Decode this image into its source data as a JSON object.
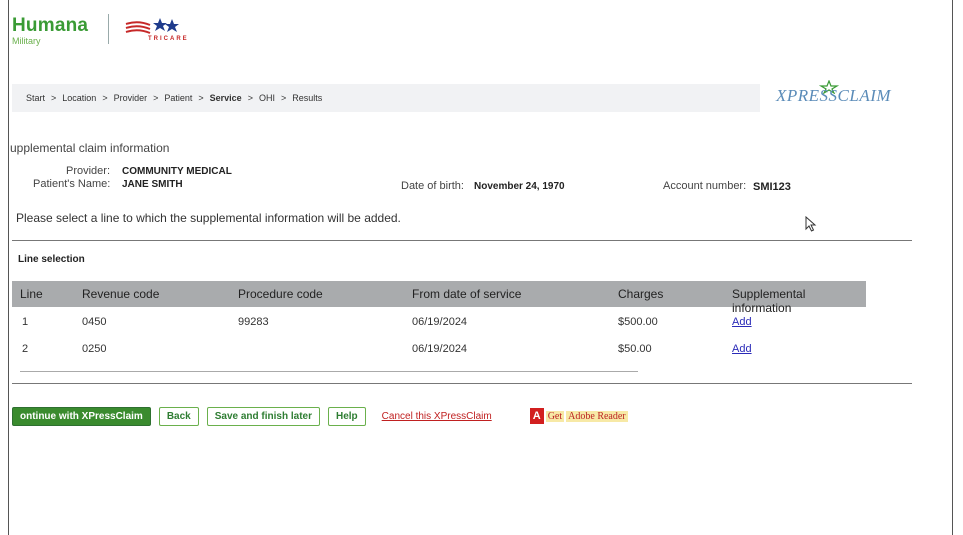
{
  "branding": {
    "humana": "Humana",
    "military": "Military",
    "tricare": "TRICARE",
    "xpressclaim_logo": "XPRESSCLAIM"
  },
  "breadcrumb": [
    {
      "label": "Start"
    },
    {
      "label": "Location"
    },
    {
      "label": "Provider"
    },
    {
      "label": "Patient"
    },
    {
      "label": "Service"
    },
    {
      "label": "OHI"
    },
    {
      "label": "Results"
    }
  ],
  "breadcrumb_separator": ">",
  "claim": {
    "section_title": "upplemental claim information",
    "provider_label": "Provider:",
    "provider_value": "COMMUNITY MEDICAL",
    "patient_label": "Patient's Name:",
    "patient_value": "JANE SMITH",
    "dob_label": "Date of birth:",
    "dob_value": "November 24, 1970",
    "account_label": "Account number:",
    "account_value": "SMI123"
  },
  "instructions": "Please select a line to which the supplemental information will be added.",
  "line_selection_title": "Line selection",
  "table": {
    "headers": [
      "Line",
      "Revenue code",
      "Procedure code",
      "From date of service",
      "Charges",
      "Supplemental information"
    ],
    "rows": [
      {
        "line": "1",
        "revenue_code": "0450",
        "procedure_code": "99283",
        "from_date": "06/19/2024",
        "charges": "$500.00",
        "action": "Add"
      },
      {
        "line": "2",
        "revenue_code": "0250",
        "procedure_code": "",
        "from_date": "06/19/2024",
        "charges": "$50.00",
        "action": "Add"
      }
    ]
  },
  "actions": {
    "continue": "ontinue with XPressClaim",
    "back": "Back",
    "save": "Save and finish later",
    "help": "Help",
    "cancel": "Cancel this XPressClaim",
    "adobe_get": "Get",
    "adobe_reader": "Adobe Reader"
  },
  "colors": {
    "humana_green": "#3a9b35",
    "primary_button": "#3a8b2e",
    "table_header": "#a9abad",
    "link": "#2a2ab8",
    "cancel_link": "#c02020"
  }
}
